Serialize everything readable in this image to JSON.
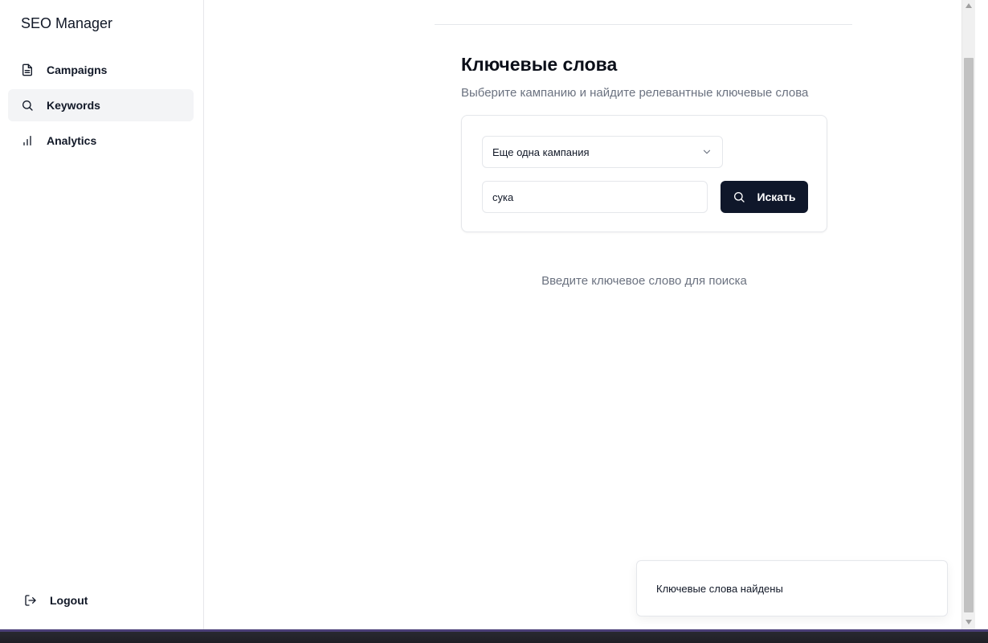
{
  "sidebar": {
    "brand": "SEO Manager",
    "items": [
      {
        "label": "Campaigns",
        "icon": "file-text-icon",
        "active": false
      },
      {
        "label": "Keywords",
        "icon": "search-icon",
        "active": true
      },
      {
        "label": "Analytics",
        "icon": "bar-chart-icon",
        "active": false
      }
    ],
    "logout_label": "Logout"
  },
  "main": {
    "title": "Ключевые слова",
    "subtitle": "Выберите кампанию и найдите релевантные ключевые слова",
    "campaign_select": {
      "selected": "Еще одна кампания"
    },
    "search": {
      "value": "сука",
      "placeholder": ""
    },
    "search_button_label": "Искать",
    "empty_hint": "Введите ключевое слово для поиска"
  },
  "toast": {
    "message": "Ключевые слова найдены"
  },
  "colors": {
    "primary_button": "#0f172a",
    "active_nav_bg": "#f3f4f6",
    "muted_text": "#6b7280"
  }
}
